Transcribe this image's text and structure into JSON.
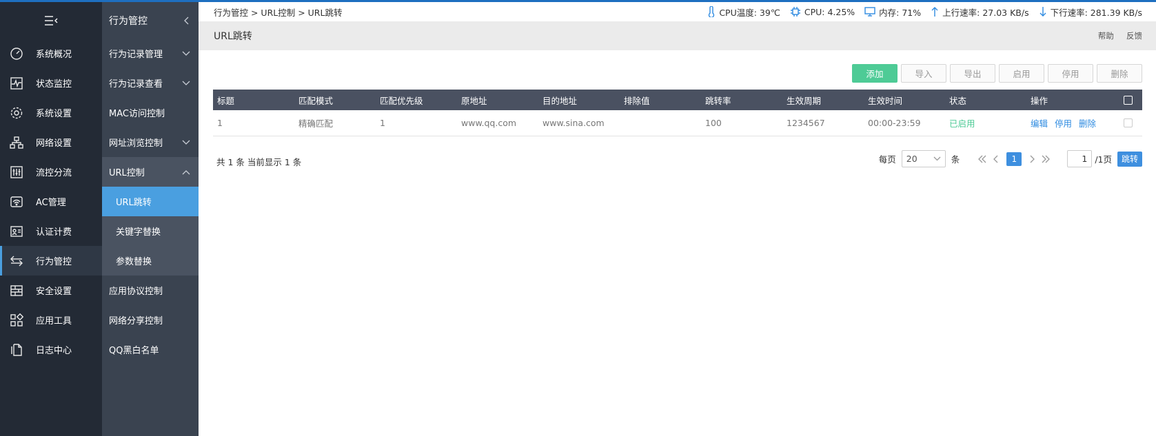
{
  "sidebar": {
    "items": [
      {
        "label": "系统概况"
      },
      {
        "label": "状态监控"
      },
      {
        "label": "系统设置"
      },
      {
        "label": "网络设置"
      },
      {
        "label": "流控分流"
      },
      {
        "label": "AC管理"
      },
      {
        "label": "认证计费"
      },
      {
        "label": "行为管控"
      },
      {
        "label": "安全设置"
      },
      {
        "label": "应用工具"
      },
      {
        "label": "日志中心"
      }
    ]
  },
  "subnav": {
    "title": "行为管控",
    "items": [
      {
        "label": "行为记录管理"
      },
      {
        "label": "行为记录查看"
      },
      {
        "label": "MAC访问控制"
      },
      {
        "label": "网址浏览控制"
      },
      {
        "label": "URL控制"
      }
    ],
    "url_sub": [
      {
        "label": "URL跳转"
      },
      {
        "label": "关键字替换"
      },
      {
        "label": "参数替换"
      }
    ],
    "rest": [
      {
        "label": "应用协议控制"
      },
      {
        "label": "网络分享控制"
      },
      {
        "label": "QQ黑白名单"
      }
    ]
  },
  "breadcrumb": {
    "text": "行为管控 > URL控制 > URL跳转"
  },
  "stats": {
    "cpu_temp": "CPU温度: 39℃",
    "cpu": "CPU: 4.25%",
    "memory": "内存: 71%",
    "upload": "上行速率: 27.03 KB/s",
    "download": "下行速率: 281.39 KB/s"
  },
  "page": {
    "title": "URL跳转",
    "help": "帮助",
    "feedback": "反馈"
  },
  "toolbar": {
    "add": "添加",
    "import": "导入",
    "export": "导出",
    "enable": "启用",
    "disable": "停用",
    "delete": "删除"
  },
  "table": {
    "headers": [
      "标题",
      "匹配模式",
      "匹配优先级",
      "原地址",
      "目的地址",
      "排除值",
      "跳转率",
      "生效周期",
      "生效时间",
      "状态",
      "操作"
    ],
    "rows": [
      {
        "title": "1",
        "mode": "精确匹配",
        "priority": "1",
        "src": "www.qq.com",
        "dst": "www.sina.com",
        "exclude": "",
        "rate": "100",
        "period": "1234567",
        "time": "00:00-23:59",
        "status": "已启用",
        "ops": [
          "编辑",
          "停用",
          "删除"
        ]
      }
    ]
  },
  "footer": {
    "total": "共 1 条 当前显示 1 条",
    "per_page_label": "每页",
    "per_page_value": "20",
    "unit": "条",
    "current_page": "1",
    "page_input": "1",
    "total_pages": "/1页",
    "jump": "跳转"
  }
}
